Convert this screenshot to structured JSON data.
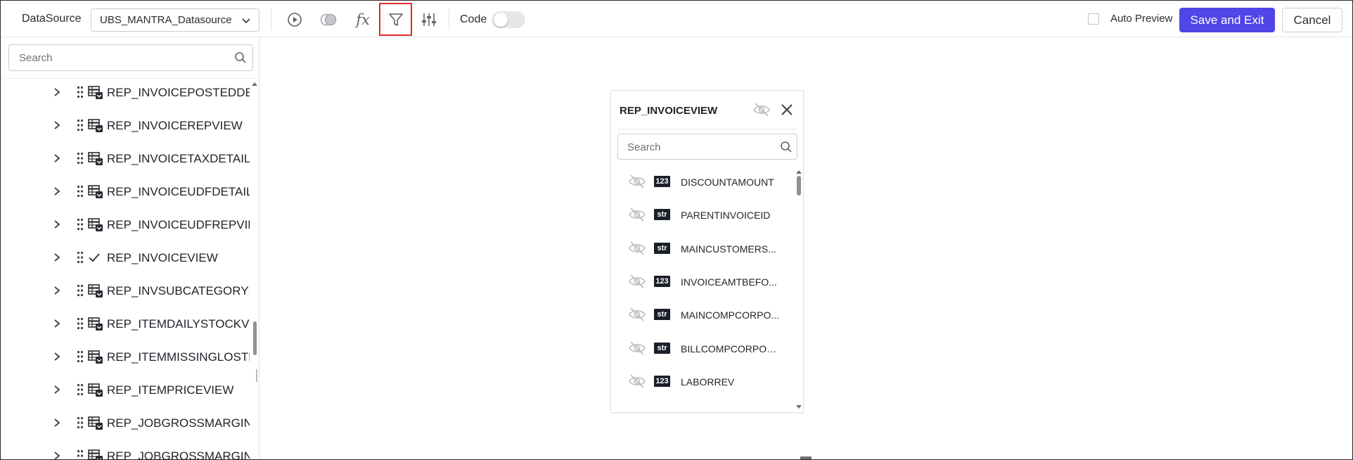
{
  "toolbar": {
    "datasource_label": "DataSource",
    "datasource_value": "UBS_MANTRA_Datasource",
    "code_label": "Code",
    "code_enabled": false,
    "auto_preview_label": "Auto Preview",
    "auto_preview_checked": false,
    "save_label": "Save and Exit",
    "cancel_label": "Cancel",
    "icons": [
      "run-icon",
      "toggle-preview-icon",
      "formula-icon",
      "filter-icon",
      "settings-sliders-icon"
    ],
    "active_icon": "filter-icon",
    "accent_color": "#4f46e5",
    "highlight_color": "#e02b2b"
  },
  "sidebar": {
    "search_placeholder": "Search",
    "items": [
      {
        "label": "REP_INVOICEPOSTEDDET",
        "icon": "table-icon",
        "selected": false
      },
      {
        "label": "REP_INVOICEREPVIEW",
        "icon": "table-icon",
        "selected": false
      },
      {
        "label": "REP_INVOICETAXDETAILV",
        "icon": "table-icon",
        "selected": false
      },
      {
        "label": "REP_INVOICEUDFDETAILV",
        "icon": "table-icon",
        "selected": false
      },
      {
        "label": "REP_INVOICEUDFREPVIEW",
        "icon": "table-icon",
        "selected": false
      },
      {
        "label": "REP_INVOICEVIEW",
        "icon": "check-icon",
        "selected": true
      },
      {
        "label": "REP_INVSUBCATEGORYLO",
        "icon": "table-icon",
        "selected": false
      },
      {
        "label": "REP_ITEMDAILYSTOCKVIE",
        "icon": "table-icon",
        "selected": false
      },
      {
        "label": "REP_ITEMMISSINGLOSTD",
        "icon": "table-icon",
        "selected": false
      },
      {
        "label": "REP_ITEMPRICEVIEW",
        "icon": "table-icon",
        "selected": false
      },
      {
        "label": "REP_JOBGROSSMARGIND",
        "icon": "table-icon",
        "selected": false
      },
      {
        "label": "REP_JOBGROSSMARGINS",
        "icon": "table-icon",
        "selected": false
      }
    ]
  },
  "table_panel": {
    "title": "REP_INVOICEVIEW",
    "search_placeholder": "Search",
    "fields": [
      {
        "type": "123",
        "name": "DISCOUNTAMOUNT"
      },
      {
        "type": "str",
        "name": "PARENTINVOICEID"
      },
      {
        "type": "str",
        "name": "MAINCUSTOMERS..."
      },
      {
        "type": "123",
        "name": "INVOICEAMTBEFO..."
      },
      {
        "type": "str",
        "name": "MAINCOMPCORPO..."
      },
      {
        "type": "str",
        "name": "BILLCOMPCORPOR..."
      },
      {
        "type": "123",
        "name": "LABORREV"
      }
    ]
  }
}
